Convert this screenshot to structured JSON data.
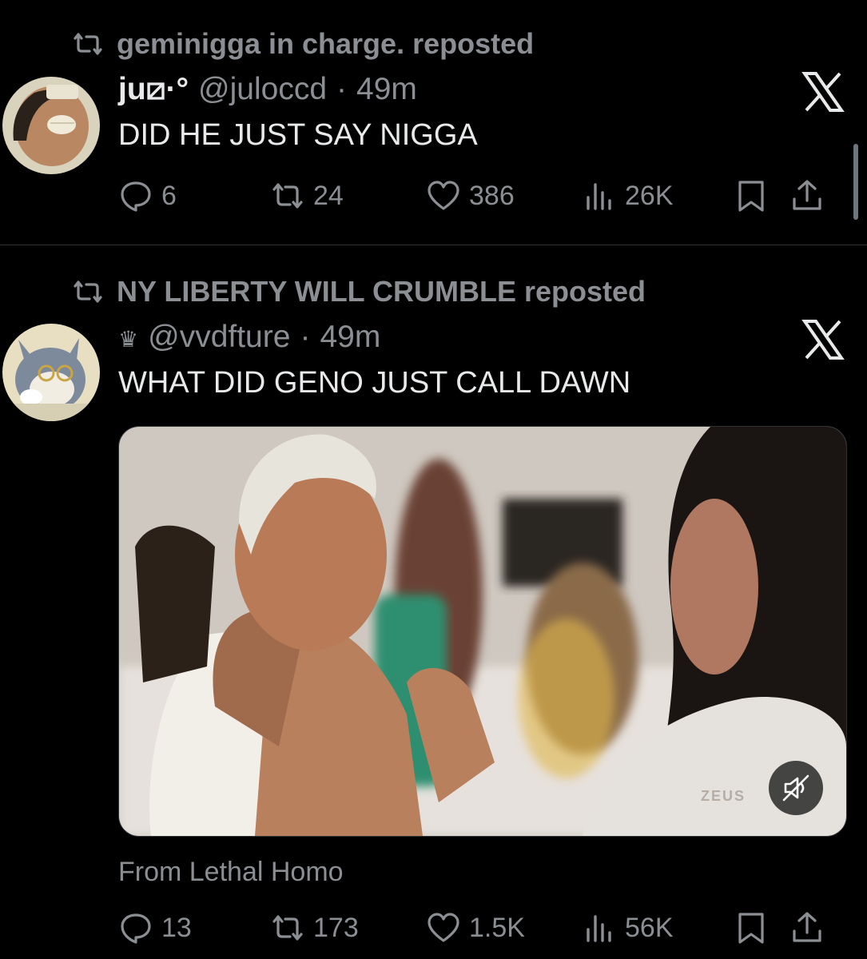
{
  "post1": {
    "repost_by": "geminigga in charge. reposted",
    "name": "ju⧄·°",
    "handle": "@juloccd",
    "sep": "·",
    "time": "49m",
    "text": "DID HE JUST SAY NIGGA",
    "replies": "6",
    "reposts": "24",
    "likes": "386",
    "views": "26K"
  },
  "post2": {
    "repost_by": "NY LIBERTY WILL CRUMBLE reposted",
    "name": "♛",
    "handle": "@vvdfture",
    "sep": "·",
    "time": "49m",
    "text": "WHAT DID GENO JUST CALL DAWN",
    "media_caption": "From Lethal Homo",
    "watermark": "ZEUS",
    "replies": "13",
    "reposts": "173",
    "likes": "1.5K",
    "views": "56K"
  }
}
